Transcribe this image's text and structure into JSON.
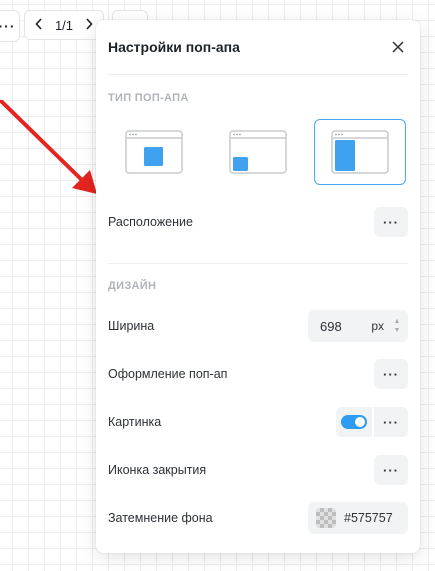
{
  "toolbar": {
    "menu_icon": "more-horizontal-icon",
    "page_indicator": "1/1",
    "prev_icon": "chevron-left-icon",
    "next_icon": "chevron-right-icon"
  },
  "annotation": {
    "arrow_color": "#e5241f"
  },
  "panel": {
    "title": "Настройки поп-апа",
    "close_icon": "close-icon",
    "type_section": {
      "label": "ТИП ПОП-АПА",
      "options": [
        {
          "name": "center",
          "selected": false
        },
        {
          "name": "corner",
          "selected": true
        },
        {
          "name": "side",
          "selected": true
        }
      ],
      "selected_index": 2
    },
    "position": {
      "label": "Расположение"
    },
    "design_section": {
      "label": "ДИЗАЙН"
    },
    "width": {
      "label": "Ширина",
      "value": "698",
      "unit": "px"
    },
    "style": {
      "label": "Оформление поп-ап"
    },
    "image": {
      "label": "Картинка",
      "enabled": true
    },
    "close_icon_setting": {
      "label": "Иконка закрытия"
    },
    "background_dim": {
      "label": "Затемнение фона",
      "value": "#575757"
    },
    "colors": {
      "accent": "#2e9cf0",
      "selected_border": "#4aa8f2",
      "field_bg": "#f2f3f5",
      "section_label": "#b0b4ba"
    }
  }
}
